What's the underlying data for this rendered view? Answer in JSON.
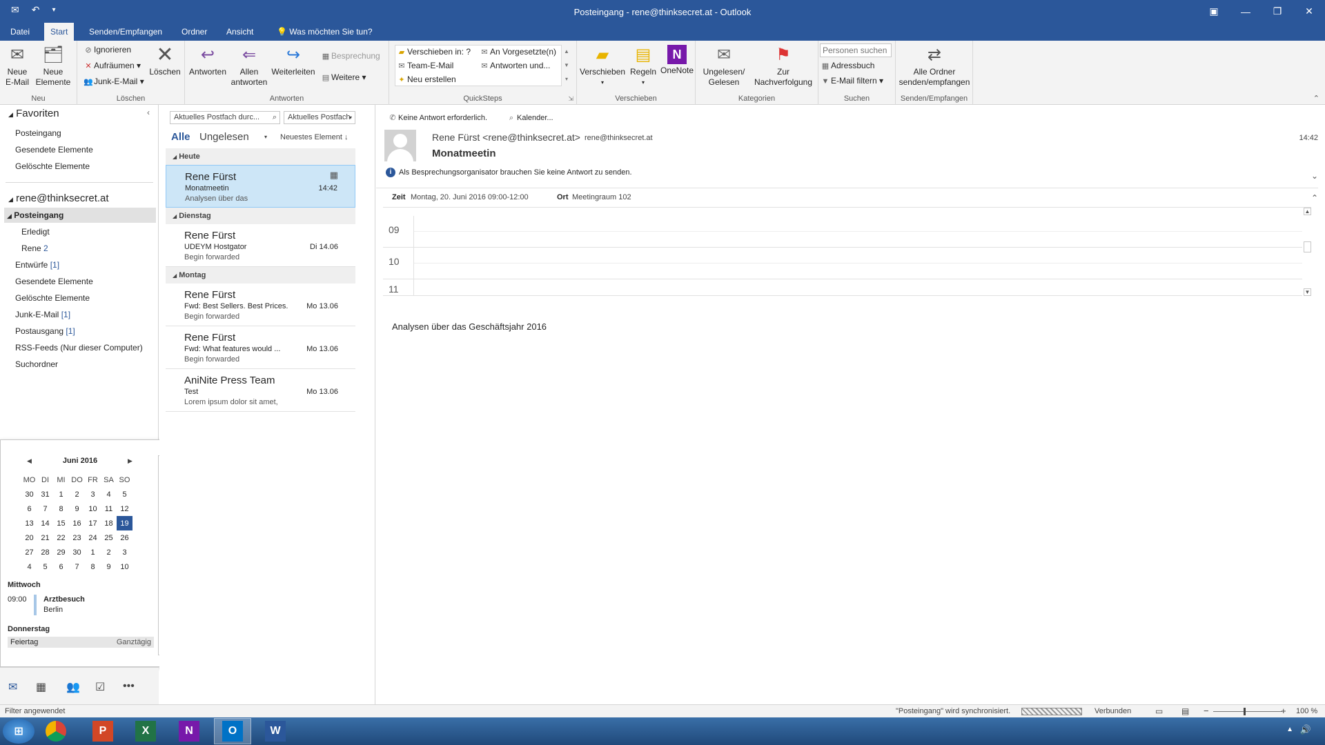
{
  "window": {
    "title": "Posteingang - rene@thinksecret.at - Outlook",
    "controls": [
      "▣",
      "—",
      "❐",
      "✕"
    ]
  },
  "tabs": [
    "Datei",
    "Start",
    "Senden/Empfangen",
    "Ordner",
    "Ansicht",
    "Was möchten Sie tun?"
  ],
  "ribbon": {
    "neu": {
      "label": "Neu",
      "new_email": "Neue\nE-Mail",
      "new_items": "Neue\nElemente"
    },
    "loeschen": {
      "label": "Löschen",
      "ignore": "Ignorieren",
      "cleanup": "Aufräumen",
      "junk": "Junk-E-Mail",
      "delete": "Löschen"
    },
    "antworten": {
      "label": "Antworten",
      "reply": "Antworten",
      "reply_all": "Allen\nantworten",
      "forward": "Weiterleiten",
      "meeting": "Besprechung",
      "more": "Weitere"
    },
    "quicksteps": {
      "label": "QuickSteps",
      "move_to": "Verschieben in: ?",
      "manager": "An Vorgesetzte(n)",
      "team": "Team-E-Mail",
      "reply_del": "Antworten und...",
      "create": "Neu erstellen"
    },
    "verschieben": {
      "label": "Verschieben",
      "move": "Verschieben",
      "rules": "Regeln",
      "onenote": "OneNote"
    },
    "kategorien": {
      "label": "Kategorien",
      "unread": "Ungelesen/\nGelesen",
      "followup": "Zur\nNachverfolgung"
    },
    "suchen": {
      "label": "Suchen",
      "people_placeholder": "Personen suchen",
      "addressbook": "Adressbuch",
      "filter": "E-Mail filtern"
    },
    "sendrecv": {
      "label": "Senden/Empfangen",
      "all": "Alle Ordner\nsenden/empfangen"
    }
  },
  "nav": {
    "favorites_header": "Favoriten",
    "favorites": [
      "Posteingang",
      "Gesendete Elemente",
      "Gelöschte Elemente"
    ],
    "account": "rene@thinksecret.at",
    "inbox": "Posteingang",
    "inbox_sub": [
      {
        "name": "Erledigt",
        "count": ""
      },
      {
        "name": "Rene",
        "count": "2"
      }
    ],
    "folders": [
      {
        "name": "Entwürfe",
        "count": "[1]"
      },
      {
        "name": "Gesendete Elemente",
        "count": ""
      },
      {
        "name": "Gelöschte Elemente",
        "count": ""
      },
      {
        "name": "Junk-E-Mail",
        "count": "[1]"
      },
      {
        "name": "Postausgang",
        "count": "[1]"
      },
      {
        "name": "RSS-Feeds (Nur dieser Computer)",
        "count": ""
      },
      {
        "name": "Suchordner",
        "count": ""
      }
    ]
  },
  "calendar": {
    "month": "Juni 2016",
    "weekdays": [
      "MO",
      "DI",
      "MI",
      "DO",
      "FR",
      "SA",
      "SO"
    ],
    "weeks": [
      [
        "30",
        "31",
        "1",
        "2",
        "3",
        "4",
        "5"
      ],
      [
        "6",
        "7",
        "8",
        "9",
        "10",
        "11",
        "12"
      ],
      [
        "13",
        "14",
        "15",
        "16",
        "17",
        "18",
        "19"
      ],
      [
        "20",
        "21",
        "22",
        "23",
        "24",
        "25",
        "26"
      ],
      [
        "27",
        "28",
        "29",
        "30",
        "1",
        "2",
        "3"
      ],
      [
        "4",
        "5",
        "6",
        "7",
        "8",
        "9",
        "10"
      ]
    ],
    "today": "19",
    "agenda": [
      {
        "day": "Mittwoch",
        "time": "09:00",
        "title": "Arztbesuch",
        "location": "Berlin"
      },
      {
        "day": "Donnerstag",
        "title": "Feiertag",
        "note": "Ganztägig"
      }
    ]
  },
  "list": {
    "search_placeholder": "Aktuelles Postfach durc...",
    "scope": "Aktuelles Postfach",
    "filter_all": "Alle",
    "filter_unread": "Ungelesen",
    "sort": "Neuestes Element",
    "groups": [
      {
        "name": "Heute",
        "items": [
          {
            "from": "Rene Fürst",
            "subject": "Monatmeetin",
            "preview": "Analysen über das",
            "date": "14:42",
            "selected": true
          }
        ]
      },
      {
        "name": "Dienstag",
        "items": [
          {
            "from": "Rene Fürst",
            "subject": "UDEYM Hostgator",
            "preview": "Begin forwarded",
            "date": "Di 14.06"
          }
        ]
      },
      {
        "name": "Montag",
        "items": [
          {
            "from": "Rene Fürst",
            "subject": "Fwd: Best Sellers. Best Prices.",
            "preview": "Begin forwarded",
            "date": "Mo 13.06"
          },
          {
            "from": "Rene Fürst",
            "subject": "Fwd: What features would ...",
            "preview": "Begin forwarded",
            "date": "Mo 13.06"
          },
          {
            "from": "AniNite Press Team",
            "subject": "Test",
            "preview": "Lorem ipsum dolor sit amet,",
            "date": "Mo 13.06"
          }
        ]
      }
    ]
  },
  "reading": {
    "action_noresp": "Keine Antwort erforderlich.",
    "action_calendar": "Kalender...",
    "sender": "Rene Fürst <rene@thinksecret.at>",
    "to": "rene@thinksecret.at",
    "time": "14:42",
    "subject": "Monatmeetin",
    "info": "Als Besprechungsorganisator brauchen Sie keine Antwort zu senden.",
    "when_label": "Zeit",
    "when": "Montag, 20. Juni 2016 09:00-12:00",
    "where_label": "Ort",
    "where": "Meetingraum 102",
    "hours": [
      "09",
      "10",
      "11"
    ],
    "body": "Analysen über das Geschäftsjahr 2016"
  },
  "status": {
    "left": "Filter angewendet",
    "sync": "\"Posteingang\" wird synchronisiert.",
    "connected": "Verbunden",
    "zoom": "100 %"
  },
  "colors": {
    "accent": "#2b579a",
    "selected": "#cde6f7"
  }
}
